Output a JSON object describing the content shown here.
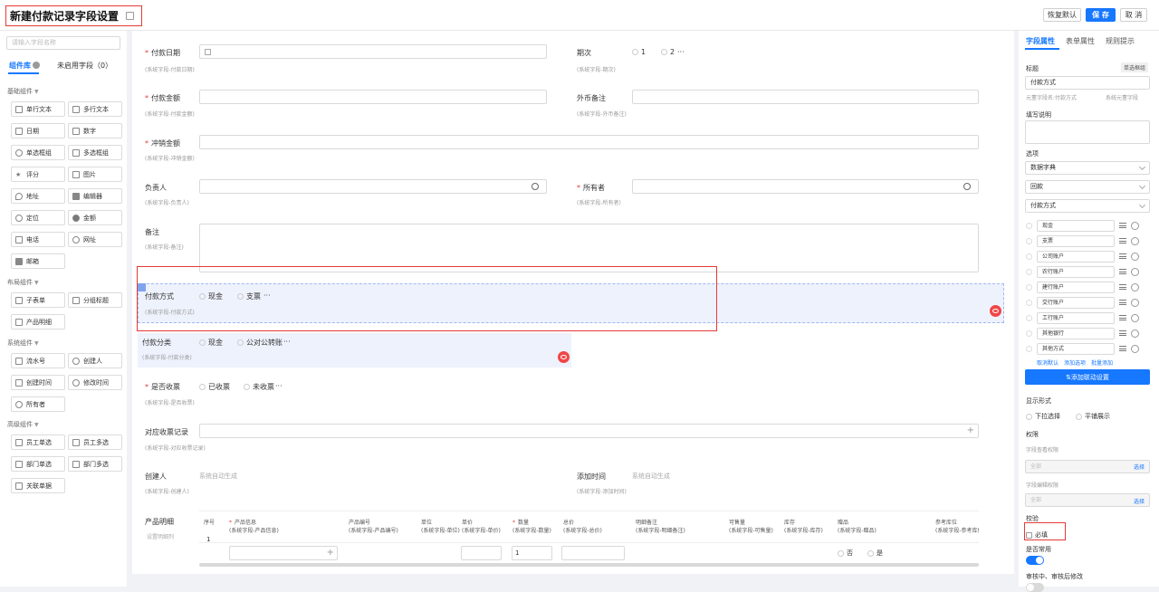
{
  "header": {
    "title": "新建付款记录字段设置",
    "buttons": {
      "restore": "恢复默认",
      "save": "保 存",
      "cancel": "取 消"
    }
  },
  "sidebar": {
    "search_placeholder": "请输入字段名称",
    "tabs": [
      "组件库",
      "未启用字段（0）"
    ],
    "groups": [
      {
        "title": "基础组件",
        "items": [
          "单行文本",
          "多行文本",
          "日期",
          "数字",
          "单选框组",
          "多选框组",
          "评分",
          "图片",
          "地址",
          "编辑器",
          "定位",
          "金额",
          "电话",
          "网址",
          "邮箱"
        ]
      },
      {
        "title": "布局组件",
        "items": [
          "子表单",
          "分组标题",
          "产品明细"
        ]
      },
      {
        "title": "系统组件",
        "items": [
          "流水号",
          "创建人",
          "创建时间",
          "修改时间",
          "所有者"
        ]
      },
      {
        "title": "高级组件",
        "items": [
          "员工单选",
          "员工多选",
          "部门单选",
          "部门多选",
          "关联单据"
        ]
      }
    ]
  },
  "form": {
    "pay_date": {
      "label": "付款日期",
      "sub": "(系统字段-付款日期)"
    },
    "period": {
      "label": "期次",
      "sub": "(系统字段-期次)",
      "options": [
        "1",
        "2"
      ],
      "more": "···"
    },
    "pay_amount": {
      "label": "付款金额",
      "sub": "(系统字段-付款金额)"
    },
    "fx_note": {
      "label": "外币备注",
      "sub": "(系统字段-外币备注)"
    },
    "offset_amount": {
      "label": "冲销金额",
      "sub": "(系统字段-冲销金额)"
    },
    "person": {
      "label": "负责人",
      "sub": "(系统字段-负责人)"
    },
    "owner": {
      "label": "所有者",
      "sub": "(系统字段-所有者)"
    },
    "remark": {
      "label": "备注",
      "sub": "(系统字段-备注)"
    },
    "pay_method": {
      "label": "付款方式",
      "sub": "(系统字段-付款方式)",
      "options": [
        "现金",
        "支票"
      ],
      "more": "···"
    },
    "pay_category": {
      "label": "付款分类",
      "sub": "(系统字段-付款分类)",
      "options": [
        "现金",
        "公对公转账"
      ],
      "more": "···"
    },
    "invoiced": {
      "label": "是否收票",
      "sub": "(系统字段-是否收票)",
      "options": [
        "已收票",
        "未收票"
      ],
      "more": "···"
    },
    "receipt_record": {
      "label": "对应收票记录",
      "sub": "(系统字段-对应收票记录)",
      "plus": "+"
    },
    "creator": {
      "label": "创建人",
      "sub": "(系统字段-创建人)",
      "auto": "系统自动生成"
    },
    "created_time": {
      "label": "添加时间",
      "sub": "(系统字段-添加时间)",
      "auto": "系统自动生成"
    },
    "product": {
      "label": "产品明细",
      "sub": "设置明细列",
      "columns": [
        {
          "t": "序号",
          "s": ""
        },
        {
          "t": "产品信息",
          "s": "(系统字段-产品信息)"
        },
        {
          "t": "产品编号",
          "s": "(系统字段-产品编号)"
        },
        {
          "t": "单位",
          "s": "(系统字段-单位)"
        },
        {
          "t": "单价",
          "s": "(系统字段-单价)"
        },
        {
          "t": "数量",
          "s": "(系统字段-数量)"
        },
        {
          "t": "总价",
          "s": "(系统字段-总价)"
        },
        {
          "t": "明细备注",
          "s": "(系统字段-明细备注)"
        },
        {
          "t": "可售量",
          "s": "(系统字段-可售量)"
        },
        {
          "t": "库存",
          "s": "(系统字段-库存)"
        },
        {
          "t": "赠品",
          "s": "(系统字段-赠品)"
        },
        {
          "t": "参考库位",
          "s": "(系统字段-参考库位)"
        }
      ],
      "row_no": "1",
      "qty": "1",
      "gift_options": [
        "否",
        "是"
      ]
    }
  },
  "panel": {
    "tabs": [
      "字段属性",
      "表单属性",
      "规则提示"
    ],
    "title_label": "标题",
    "type_badge": "单选框组",
    "title_value": "付款方式",
    "alias": "元董字段名:付款方式",
    "system_tag": "系统元董字段",
    "desc_label": "填写说明",
    "options_label": "选项",
    "selects": [
      "数据字典",
      "回款",
      "付款方式"
    ],
    "options": [
      "现金",
      "支票",
      "公司账户",
      "农行账户",
      "建行账户",
      "交行账户",
      "工行账户",
      "其他银行",
      "其他方式"
    ],
    "links": [
      "取消默认",
      "添加选项",
      "批量添加"
    ],
    "linkage_btn": "⇅添加联动设置",
    "display_label": "显示形式",
    "display_options": [
      "下拉选择",
      "平铺展示"
    ],
    "perm_label": "权限",
    "view_perm": "字段查看权限",
    "edit_perm": "字段编辑权限",
    "all": "全部",
    "choose": "选择",
    "verify_label": "校验",
    "required": "必填",
    "common_label": "是否常用",
    "audit_label": "审核中、审核后修改"
  }
}
